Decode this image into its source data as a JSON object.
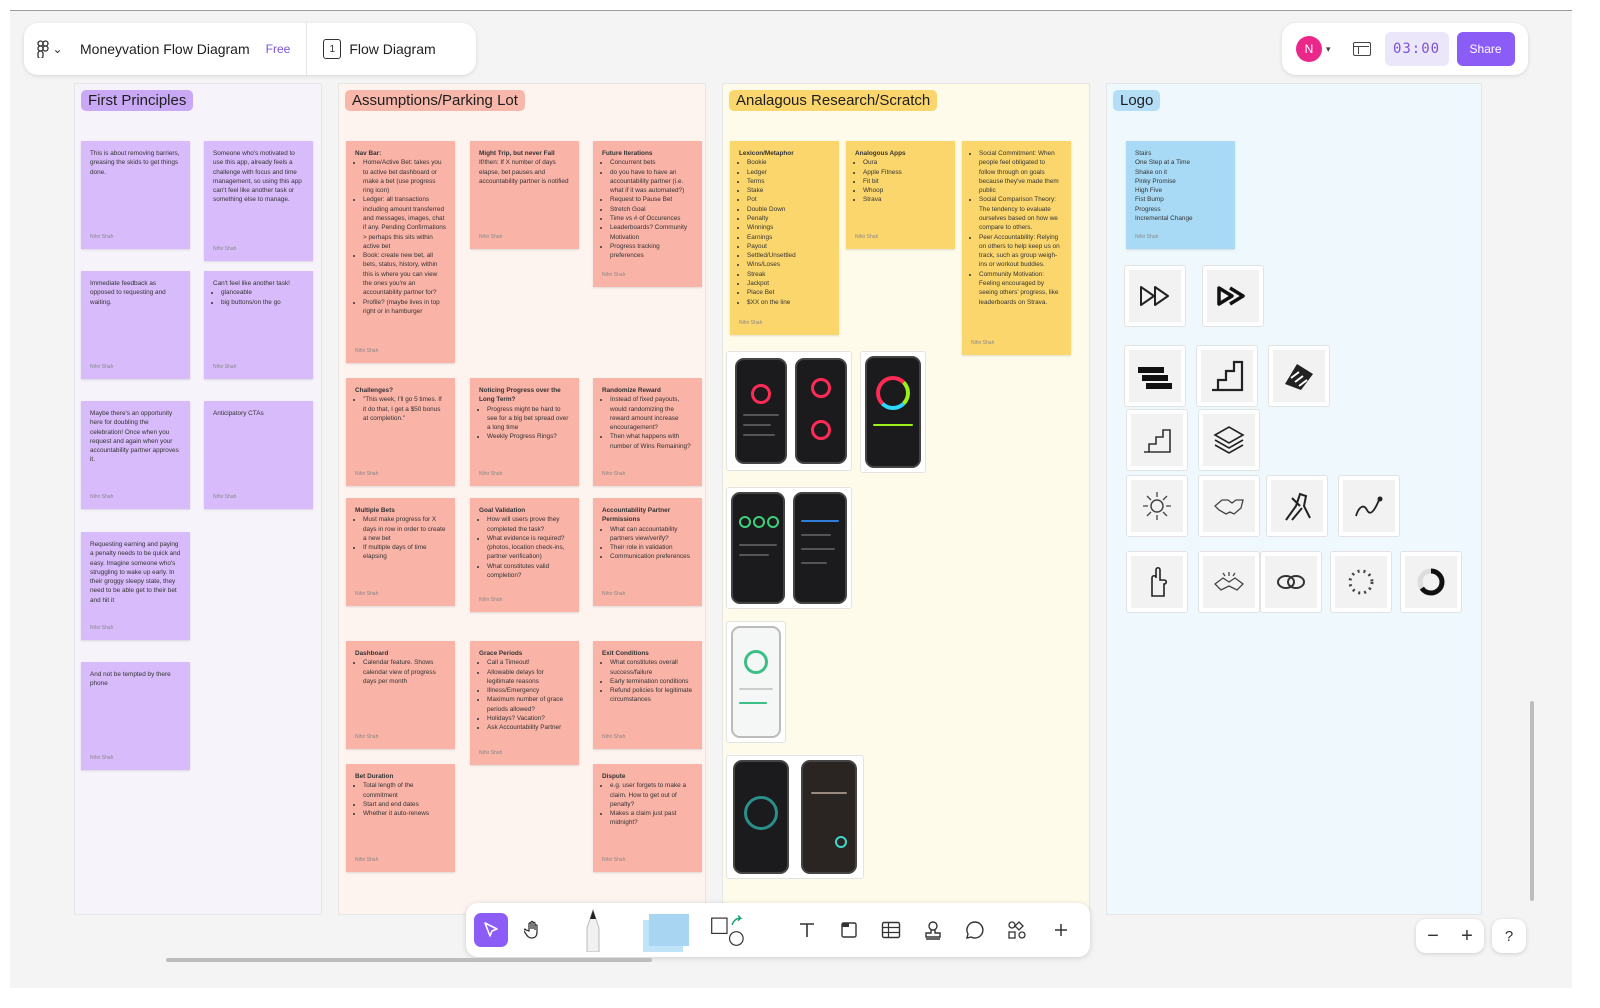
{
  "header": {
    "file_title": "Moneyvation Flow Diagram",
    "plan_badge": "Free",
    "page_number": "1",
    "page_name": "Flow Diagram",
    "avatar_initial": "N",
    "timer": "03:00",
    "share_label": "Share"
  },
  "sections": {
    "first_principles": "First Principles",
    "assumptions": "Assumptions/Parking Lot",
    "research": "Analagous Research/Scratch",
    "logo": "Logo"
  },
  "author": "Nihir Shah",
  "fp_notes": [
    {
      "text": "This is about removing barriers, greasing the skids to get things done."
    },
    {
      "text": "Someone who's motivated to use this app, already feels a challenge with focus and time management, so using this app can't feel like another task or something else to manage."
    },
    {
      "text": "Immediate feedback as opposed to requesting and waiting."
    },
    {
      "text": "Can't feel like another task!",
      "items": [
        "glanceable",
        "big buttons/on the go"
      ]
    },
    {
      "text": "Maybe there's an opportunity here for doubling the celebration! Once when you request and again when your accountability partner approves it."
    },
    {
      "text": "Anticipatory CTAs"
    },
    {
      "text": "Requesting earning and paying a penalty needs to be quick and easy. Imagine someone who's struggling to wake up early. In their groggy sleepy state, they need to be able get to their bet and hit it"
    },
    {
      "text": "And not be tempted by there phone"
    }
  ],
  "ap_notes": [
    {
      "title": "Nav Bar:",
      "items": [
        "Home/Active Bet: takes you to active bet dashboard or make a bet (use progress ring icon)",
        "Ledger: all transactions including amount transferred and messages, images, chat if any. Pending Confirmations > perhaps this sits within active bet",
        "Book: create new bet, all bets, status, history, within this is where you can view the ones you're an accountability partner for?",
        "Profile? (maybe lives in top right or in hamburger"
      ]
    },
    {
      "title": "Might Trip, but never Fall",
      "text": "If/then: If X number of days elapse, bet pauses and accountability partner is notified"
    },
    {
      "title": "Future Iterations",
      "items": [
        "Concurrent bets",
        "do you have to have an accountability partner (i.e. what if it was automated?)",
        "Request to Pause Bet",
        "Stretch Goal",
        "Time vs # of Occurences",
        "Leaderboards? Community Motivation",
        "Progress tracking preferences"
      ]
    },
    {
      "title": "Challenges?",
      "items": [
        "\"This week, I'll go 5 times. If it do that, I get a $50 bonus at completion.\""
      ]
    },
    {
      "title": "Noticing Progress over the Long Term?",
      "items": [
        "Progress might be hard to see for a big bet spread over a long time",
        "Weekly Progress Rings?"
      ]
    },
    {
      "title": "Randomize Reward",
      "items": [
        "Instead of fixed payouts, would randomizing the reward amount increase encouragement?",
        "Then what happens with number of Wins Remaining?"
      ]
    },
    {
      "title": "Multiple Bets",
      "items": [
        "Must make progress for X days in row in order to create a new bet",
        "If multiple days of time elapsing"
      ]
    },
    {
      "title": "Goal Validation",
      "items": [
        "How will users prove they completed the task?",
        "What evidence is required? (photos, location check-ins, partner verification)",
        "What constitutes valid completion?"
      ]
    },
    {
      "title": "Accountability Partner Permissions",
      "items": [
        "What can accountability partners view/verify?",
        "Their role in validation",
        "Communication preferences"
      ]
    },
    {
      "title": "Dashboard",
      "items": [
        "Calendar feature. Shows calendar view of progress days per month"
      ]
    },
    {
      "title": "Grace Periods",
      "items": [
        "Call a Timeout!",
        "Allowable delays for legitimate reasons",
        "Illness/Emergency",
        "Maximum number of grace periods allowed?",
        "Holidays? Vacation?",
        "Ask Accountability Partner"
      ]
    },
    {
      "title": "Exit Conditions",
      "items": [
        "What constitutes overall success/failure",
        "Early termination conditions",
        "Refund policies for legitimate circumstances"
      ]
    },
    {
      "title": "Bet Duration",
      "items": [
        "Total length of the commitment",
        "Start and end dates",
        "Whether it auto-renews"
      ]
    },
    {
      "title": "Dispute",
      "items": [
        "e.g. user forgets to make a claim. How to get out of penalty?",
        "Makes a claim just past midnight?"
      ]
    }
  ],
  "ar_notes": [
    {
      "title": "Lexicon/Metaphor",
      "items": [
        "Bookie",
        "Ledger",
        "Terms",
        "Stake",
        "Pot",
        "Double Down",
        "Penalty",
        "Winnings",
        "Earnings",
        "Payout",
        "Settled/Unsettled",
        "Wins/Loses",
        "Streak",
        "Jackpot",
        "Place Bet",
        "$XX on the line"
      ]
    },
    {
      "title": "Analogous Apps",
      "items": [
        "Oura",
        "Apple Fitness",
        "Fit bit",
        "Whoop",
        "Strava"
      ]
    },
    {
      "items": [
        "Social Commitment: When people feel obligated to follow through on goals because they've made them public",
        "Social Comparison Theory: The tendency to evaluate ourselves based on how we compare to others.",
        "Peer Accountability: Relying on others to help keep us on track, such as group weigh-ins or workout buddies.",
        "Community Motivation: Feeling encouraged by seeing others' progress, like leaderboards on Strava."
      ]
    }
  ],
  "logo_note": {
    "lines": [
      "Stairs",
      "One Step at a Time",
      "Shake on it",
      "Pinky Promise",
      "High Five",
      "Fist Bump",
      "Progress",
      "Incremental Change"
    ]
  },
  "logo_tiles": [
    "fast-forward-icon",
    "double-loop-forward-icon",
    "layered-stairs-icon",
    "stairs-outline-icon",
    "isometric-stairs-icon",
    "small-stairs-icon",
    "stacked-stairs-icon",
    "fist-bump-icon",
    "handshake-icon",
    "arm-wrestle-icon",
    "upward-curve-icon",
    "pinky-promise-icon",
    "shake-hands-icon",
    "linked-hands-icon",
    "dotted-ring-icon",
    "progress-ring-icon"
  ],
  "colors": {
    "purple_note": "#d8bbfa",
    "salmon_note": "#f9b3a7",
    "yellow_note": "#fbd66d",
    "blue_note": "#a8daf5",
    "accent": "#8b5cf6",
    "avatar": "#e9288a"
  },
  "toolbar": {
    "tools": [
      "move-tool-icon",
      "hand-tool-icon",
      "pen-tool-icon",
      "sticky-note-tool-icon",
      "shape-tool-icon",
      "text-tool-icon",
      "section-tool-icon",
      "table-tool-icon",
      "stamp-tool-icon",
      "comment-tool-icon",
      "widgets-tool-icon",
      "more-tools-icon"
    ]
  },
  "zoom": {
    "minus": "−",
    "plus": "+"
  },
  "help_label": "?"
}
